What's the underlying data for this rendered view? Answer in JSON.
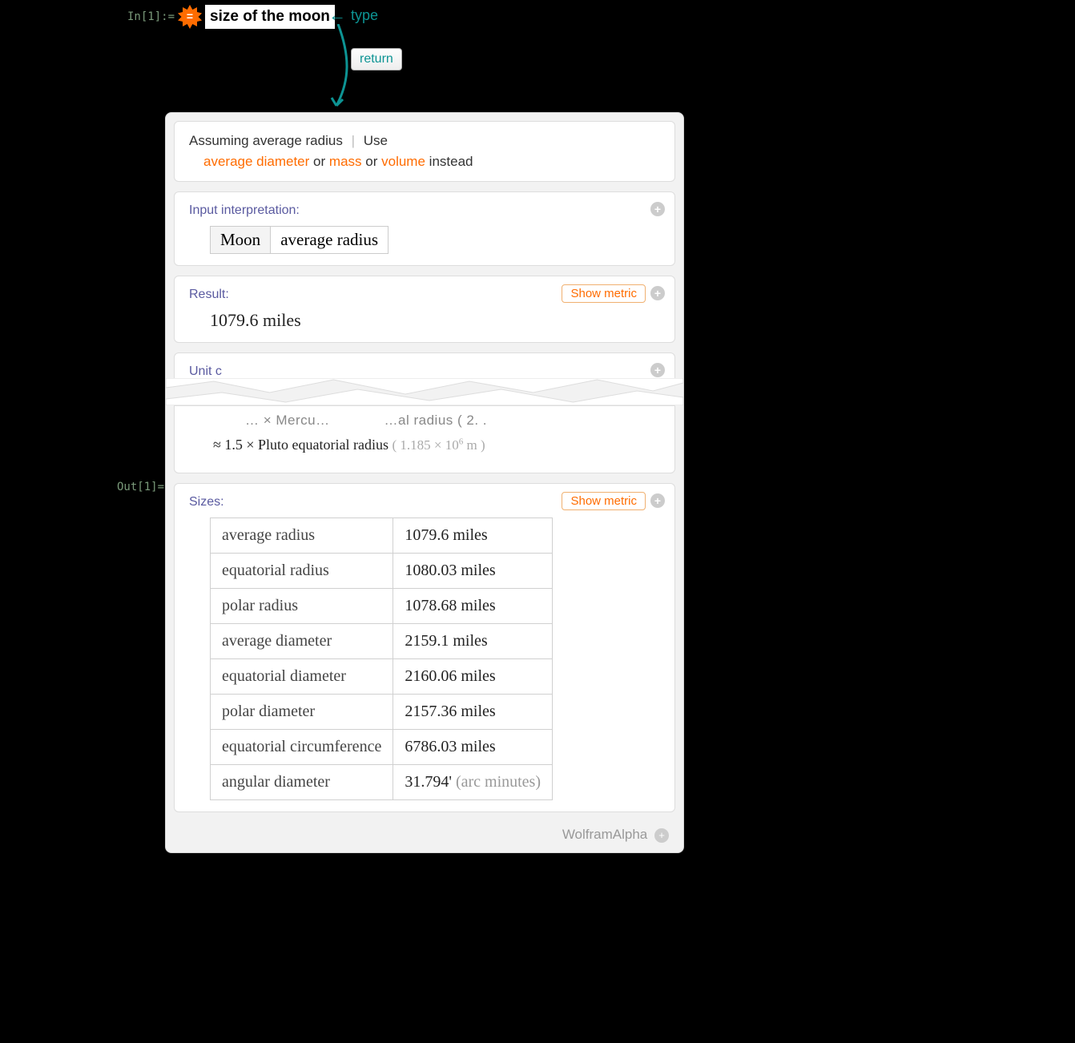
{
  "input": {
    "in_label": "In[1]:=",
    "query": "size of the moon",
    "annotation_type": "type",
    "return_key": "return"
  },
  "output_label": "Out[1]=",
  "assumption": {
    "prefix": "Assuming average radius",
    "use": "Use",
    "alt1": "average diameter",
    "or1": "or",
    "alt2": "mass",
    "or2": "or",
    "alt3": "volume",
    "suffix": "instead"
  },
  "interpretation": {
    "title": "Input interpretation:",
    "entity": "Moon",
    "property": "average radius"
  },
  "result": {
    "title": "Result:",
    "value": "1079.6 miles",
    "show_metric": "Show metric"
  },
  "unit_pod_title": "Unit c",
  "comparison": {
    "fragment_left": "… × Mercu…",
    "fragment_right": "…al radius ( 2. .",
    "line_prefix": "≈ 1.5",
    "line_mid": "× Pluto equatorial radius",
    "line_detail_a": "( 1.185 × 10",
    "line_detail_exp": "6",
    "line_detail_b": " m )"
  },
  "sizes": {
    "title": "Sizes:",
    "show_metric": "Show metric",
    "rows": [
      {
        "label": "average radius",
        "value": "1079.6 miles"
      },
      {
        "label": "equatorial radius",
        "value": "1080.03 miles"
      },
      {
        "label": "polar radius",
        "value": "1078.68 miles"
      },
      {
        "label": "average diameter",
        "value": "2159.1 miles"
      },
      {
        "label": "equatorial diameter",
        "value": "2160.06 miles"
      },
      {
        "label": "polar diameter",
        "value": "2157.36 miles"
      },
      {
        "label": "equatorial circumference",
        "value": "6786.03 miles"
      },
      {
        "label": "angular diameter",
        "value": "31.794'",
        "unit": "(arc minutes)"
      }
    ]
  },
  "footer": {
    "brand": "WolframAlpha"
  }
}
